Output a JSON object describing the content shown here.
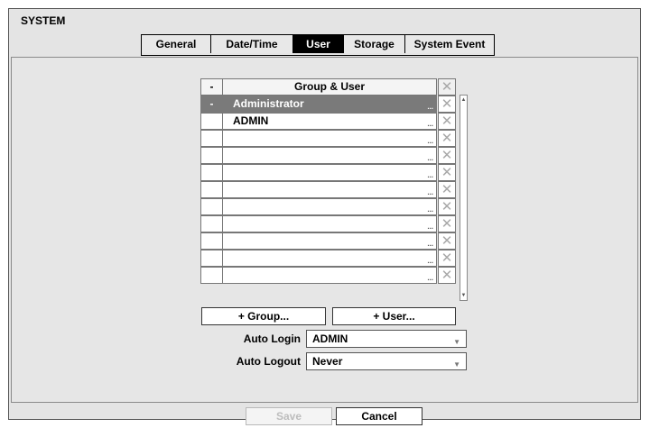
{
  "window": {
    "title": "SYSTEM"
  },
  "tabs": [
    {
      "label": "General"
    },
    {
      "label": "Date/Time"
    },
    {
      "label": "User"
    },
    {
      "label": "Storage"
    },
    {
      "label": "System Event"
    }
  ],
  "active_tab": "User",
  "table": {
    "collapse_label": "-",
    "header": "Group & User",
    "delete_icon": "close-icon",
    "rows": [
      {
        "toggle": "-",
        "name": "Administrator",
        "selected": true
      },
      {
        "toggle": "",
        "name": "ADMIN",
        "selected": false
      },
      {
        "toggle": "",
        "name": "",
        "selected": false
      },
      {
        "toggle": "",
        "name": "",
        "selected": false
      },
      {
        "toggle": "",
        "name": "",
        "selected": false
      },
      {
        "toggle": "",
        "name": "",
        "selected": false
      },
      {
        "toggle": "",
        "name": "",
        "selected": false
      },
      {
        "toggle": "",
        "name": "",
        "selected": false
      },
      {
        "toggle": "",
        "name": "",
        "selected": false
      },
      {
        "toggle": "",
        "name": "",
        "selected": false
      },
      {
        "toggle": "",
        "name": "",
        "selected": false
      }
    ]
  },
  "buttons": {
    "add_group": "+ Group...",
    "add_user": "+ User..."
  },
  "auto_login": {
    "label": "Auto Login",
    "value": "ADMIN"
  },
  "auto_logout": {
    "label": "Auto Logout",
    "value": "Never"
  },
  "footer": {
    "save": "Save",
    "cancel": "Cancel"
  }
}
